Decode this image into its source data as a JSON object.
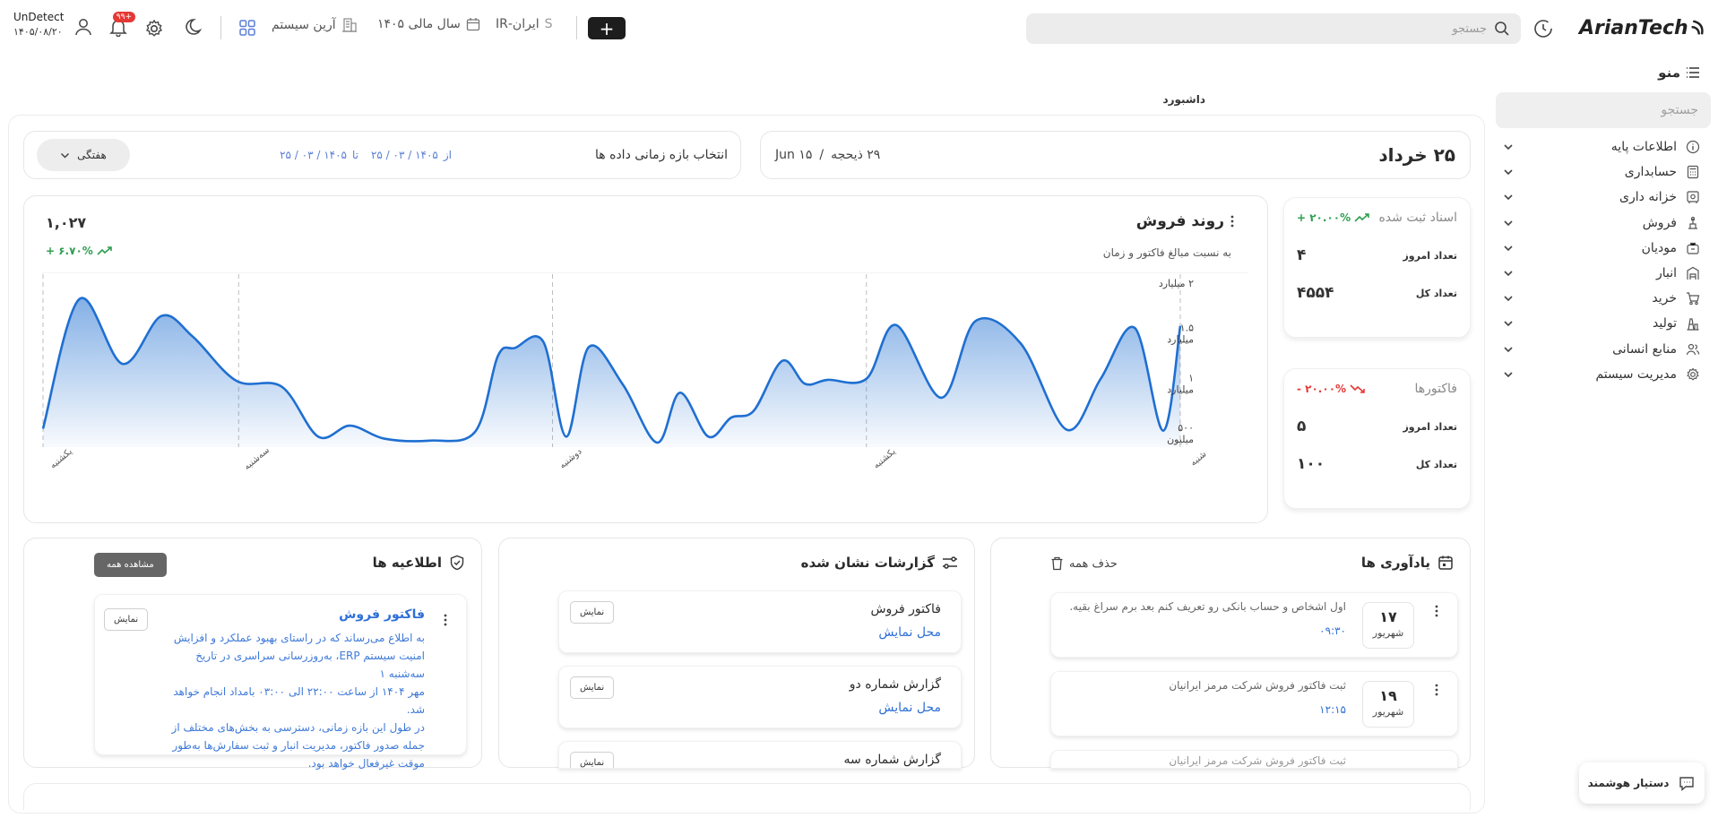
{
  "brand": {
    "logo_text": "ArianTech"
  },
  "topbar": {
    "search_placeholder": "جستجو",
    "add_label": "+",
    "region": "ایران-IR",
    "region_code": "S",
    "fiscal_year": "سال مالی ۱۴۰۵",
    "company": "آرین سیستم",
    "notifications_count": "+۹۹",
    "user_name": "UnDetect",
    "user_date": "۱۴۰۵/۰۸/۲۰"
  },
  "sidebar": {
    "title": "منو",
    "search_placeholder": "جستجو",
    "items": [
      {
        "label": "اطلاعات پایه",
        "icon": "info-icon"
      },
      {
        "label": "حسابداری",
        "icon": "calculator-icon"
      },
      {
        "label": "خزانه داری",
        "icon": "safe-icon"
      },
      {
        "label": "فروش",
        "icon": "sales-icon"
      },
      {
        "label": "مودیان",
        "icon": "tax-icon"
      },
      {
        "label": "انبار",
        "icon": "warehouse-icon"
      },
      {
        "label": "خرید",
        "icon": "cart-icon"
      },
      {
        "label": "تولید",
        "icon": "factory-icon"
      },
      {
        "label": "منابع انسانی",
        "icon": "people-icon"
      },
      {
        "label": "مدیریت سیستم",
        "icon": "gear-icon"
      }
    ]
  },
  "breadcrumb": "داشبورد",
  "date_card": {
    "shamsi": "۲۵ خرداد",
    "hijri": "۲۹ ذیحجه",
    "separator": "/",
    "gregorian": "Jun ۱۵"
  },
  "range_card": {
    "title": "انتخاب بازه زمانی داده ها",
    "from_label": "از",
    "from": "۲۵ / ۰۳ / ۱۴۰۵",
    "to_label": "تا",
    "to": "۲۵ / ۰۳ / ۱۴۰۵",
    "period": "هفتگی"
  },
  "stats": [
    {
      "title": "اسناد ثبت شده",
      "trend": "+ ۲۰.۰۰%",
      "trend_color": "#2e9e4f",
      "today_label": "تعداد امروز",
      "today": "۴",
      "total_label": "تعداد کل",
      "total": "۴۵۵۴"
    },
    {
      "title": "فاکتورها",
      "trend": "- ۲۰.۰۰%",
      "trend_color": "#e53935",
      "today_label": "تعداد امروز",
      "today": "۵",
      "total_label": "تعداد کل",
      "total": "۱۰۰"
    }
  ],
  "chart_data": {
    "type": "area",
    "title": "روند فروش",
    "subtitle": "به نسبت مبالغ فاکتور و زمان",
    "total": "۱,۰۲۷",
    "trend": "+ ۶.۷۰%",
    "y_ticks": [
      "۲ میلیارد",
      "۱.۵ میلیارد",
      "۱ میلیارد",
      "۵۰۰ میلیون"
    ],
    "y_tick_values": [
      2000000000,
      1500000000,
      1000000000,
      500000000
    ],
    "ylim": [
      400000000,
      2000000000
    ],
    "x_ticks": [
      "یکشنبه",
      "سه‌شنبه",
      "دوشنبه",
      "یکشنبه",
      "شنبه"
    ],
    "x_tick_positions": [
      0,
      0.172,
      0.448,
      0.724,
      1
    ],
    "series": [
      {
        "color": "#1f6fd1",
        "x": [
          0,
          0.032,
          0.07,
          0.104,
          0.132,
          0.17,
          0.21,
          0.242,
          0.27,
          0.3,
          0.34,
          0.38,
          0.4,
          0.415,
          0.44,
          0.46,
          0.48,
          0.51,
          0.54,
          0.56,
          0.585,
          0.605,
          0.625,
          0.65,
          0.67,
          0.69,
          0.724,
          0.75,
          0.79,
          0.82,
          0.86,
          0.9,
          0.93,
          0.96,
          0.985,
          1
        ],
        "values": [
          540000000,
          1840000000,
          1190000000,
          1670000000,
          1460000000,
          1020000000,
          960000000,
          460000000,
          570000000,
          440000000,
          420000000,
          510000000,
          1270000000,
          1350000000,
          1410000000,
          460000000,
          1360000000,
          980000000,
          400000000,
          900000000,
          460000000,
          650000000,
          720000000,
          1220000000,
          990000000,
          1030000000,
          1040000000,
          1580000000,
          850000000,
          1620000000,
          1390000000,
          530000000,
          1040000000,
          1550000000,
          520000000,
          1570000000
        ]
      }
    ],
    "grid": true
  },
  "reminders": {
    "title": "یادآوری ها",
    "clear_label": "حذف همه",
    "items": [
      {
        "day": "۱۷",
        "month": "شهریور",
        "text": "اول اشخاص و حساب بانکی رو تعریف کنم بعد برم سراغ بقیه.",
        "time": "۰۹:۳۰"
      },
      {
        "day": "۱۹",
        "month": "شهریور",
        "text": "ثبت فاکتور فروش شرکت مرمز ایرانیان",
        "time": "۱۲:۱۵"
      },
      {
        "text": "ثبت فاکتور فروش شرکت مرمز ایرانیان"
      }
    ]
  },
  "reports": {
    "title": "گزارشات نشان شده",
    "items": [
      {
        "name": "فاکتور فروش",
        "link": "محل نمایش",
        "button": "نمایش"
      },
      {
        "name": "گزارش شماره دو",
        "link": "محل نمایش",
        "button": "نمایش"
      },
      {
        "name": "گزارش شماره سه",
        "button": "نمایش"
      }
    ]
  },
  "announcements": {
    "title": "اطلاعیه ها",
    "view_all": "مشاهده همه",
    "item": {
      "title": "فاکتور فروش",
      "button": "نمایش",
      "lines": [
        "به اطلاع می‌رساند که در راستای بهبود عملکرد و افزایش",
        "امنیت سیستم ERP، به‌روزرسانی سراسری در تاریخ سه‌شنبه ۱",
        "مهر ۱۴۰۴ از ساعت ۲۲:۰۰ الی ۰۳:۰۰ بامداد انجام خواهد شد.",
        "در طول این بازه زمانی، دسترسی به بخش‌های مختلف از",
        "جمله صدور فاکتور، مدیریت انبار و ثبت سفارش‌ها به‌طور",
        "موقت غیرفعال خواهد بود."
      ]
    }
  },
  "assistant": {
    "label": "دستیار هوشمند"
  }
}
